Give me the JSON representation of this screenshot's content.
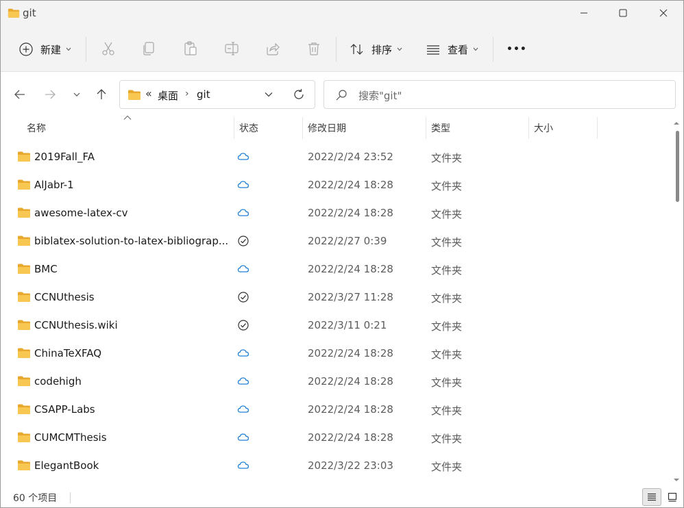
{
  "window": {
    "title": "git"
  },
  "toolbar": {
    "new_label": "新建",
    "sort_label": "排序",
    "view_label": "查看",
    "more_label": "•••"
  },
  "address": {
    "overflow": "«",
    "segment1": "桌面",
    "separator": "›",
    "segment2": "git"
  },
  "search": {
    "placeholder": "搜索\"git\""
  },
  "columns": {
    "name": "名称",
    "status": "状态",
    "modified": "修改日期",
    "type": "类型",
    "size": "大小"
  },
  "files": [
    {
      "name": "2019Fall_FA",
      "status": "cloud",
      "date": "2022/2/24 23:52",
      "type": "文件夹"
    },
    {
      "name": "AlJabr-1",
      "status": "cloud",
      "date": "2022/2/24 18:28",
      "type": "文件夹"
    },
    {
      "name": "awesome-latex-cv",
      "status": "cloud",
      "date": "2022/2/24 18:28",
      "type": "文件夹"
    },
    {
      "name": "biblatex-solution-to-latex-bibliograp...",
      "status": "synced",
      "date": "2022/2/27 0:39",
      "type": "文件夹"
    },
    {
      "name": "BMC",
      "status": "cloud",
      "date": "2022/2/24 18:28",
      "type": "文件夹"
    },
    {
      "name": "CCNUthesis",
      "status": "synced",
      "date": "2022/3/27 11:28",
      "type": "文件夹"
    },
    {
      "name": "CCNUthesis.wiki",
      "status": "synced",
      "date": "2022/3/11 0:21",
      "type": "文件夹"
    },
    {
      "name": "ChinaTeXFAQ",
      "status": "cloud",
      "date": "2022/2/24 18:28",
      "type": "文件夹"
    },
    {
      "name": "codehigh",
      "status": "cloud",
      "date": "2022/2/24 18:28",
      "type": "文件夹"
    },
    {
      "name": "CSAPP-Labs",
      "status": "cloud",
      "date": "2022/2/24 18:28",
      "type": "文件夹"
    },
    {
      "name": "CUMCMThesis",
      "status": "cloud",
      "date": "2022/2/24 18:28",
      "type": "文件夹"
    },
    {
      "name": "ElegantBook",
      "status": "cloud",
      "date": "2022/3/22 23:03",
      "type": "文件夹"
    }
  ],
  "statusbar": {
    "item_count": "60 个项目"
  },
  "colors": {
    "folder": "#f5c04a",
    "cloud": "#1f7fd6",
    "accent": "#0067c0"
  }
}
